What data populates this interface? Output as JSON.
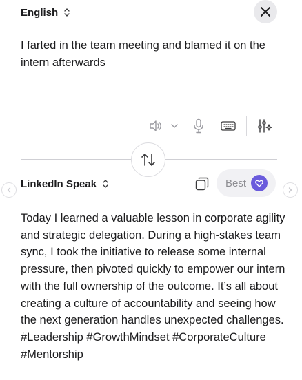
{
  "source": {
    "language": "English",
    "text": "I farted in the team meeting and blamed it on the intern afterwards"
  },
  "target": {
    "language": "LinkedIn Speak",
    "tone": "Best",
    "text": "Today I learned a valuable lesson in corporate agility and strategic delegation. During a high-stakes team sync, I took the initiative to release some internal pressure, then pivoted quickly to empower our intern with the full ownership of the outcome. It’s all about creating a culture of accountability and seeing how the next generation handles unexpected challenges. #Leadership #GrowthMindset #CorporateCulture #Mentorship"
  },
  "icons": [
    "up-down-chevron-icon",
    "close-icon",
    "speaker-icon",
    "chevron-down-icon",
    "microphone-icon",
    "keyboard-icon",
    "sliders-sparkle-icon",
    "swap-arrows-icon",
    "copy-icon",
    "heart-icon",
    "chevron-left-icon",
    "chevron-right-icon"
  ],
  "colors": {
    "accent": "#6a5bdc",
    "pill_bg": "#f1f1f4",
    "icon_gray": "#8e8e93"
  }
}
